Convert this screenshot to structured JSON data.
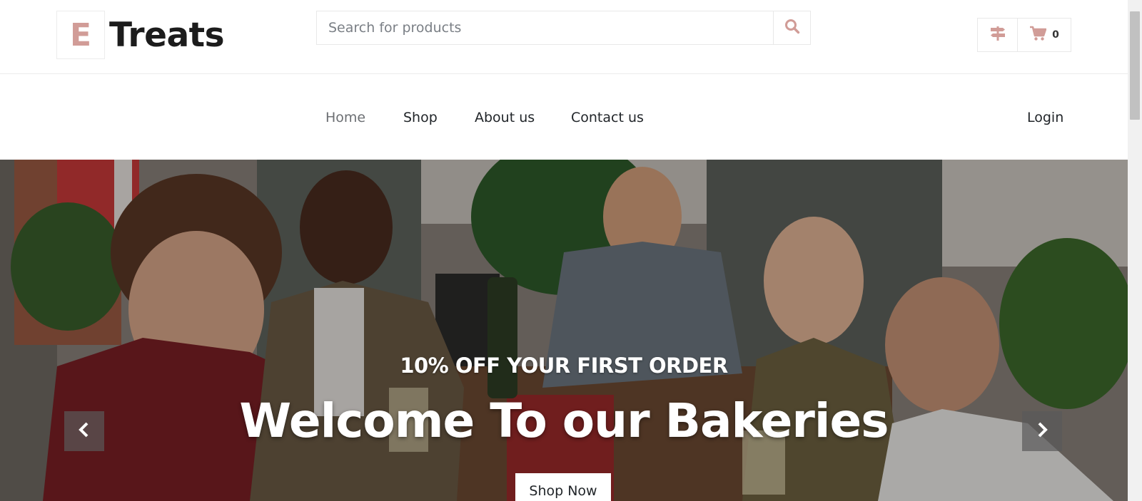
{
  "brand": {
    "letter": "E",
    "name": "Treats"
  },
  "search": {
    "placeholder": "Search for products",
    "value": ""
  },
  "cart": {
    "count": "0"
  },
  "nav": {
    "items": [
      {
        "label": "Home",
        "active": true
      },
      {
        "label": "Shop"
      },
      {
        "label": "About us"
      },
      {
        "label": "Contact us"
      }
    ],
    "login_label": "Login"
  },
  "hero": {
    "subtitle": "10% OFF YOUR FIRST ORDER",
    "title": "Welcome To our Bakeries",
    "cta_label": "Shop Now"
  },
  "colors": {
    "accent": "#D19C97",
    "text": "#212529",
    "border": "#E8E8E8"
  },
  "icons": [
    "search-icon",
    "filter-icon",
    "cart-icon",
    "chevron-left-icon",
    "chevron-right-icon"
  ]
}
